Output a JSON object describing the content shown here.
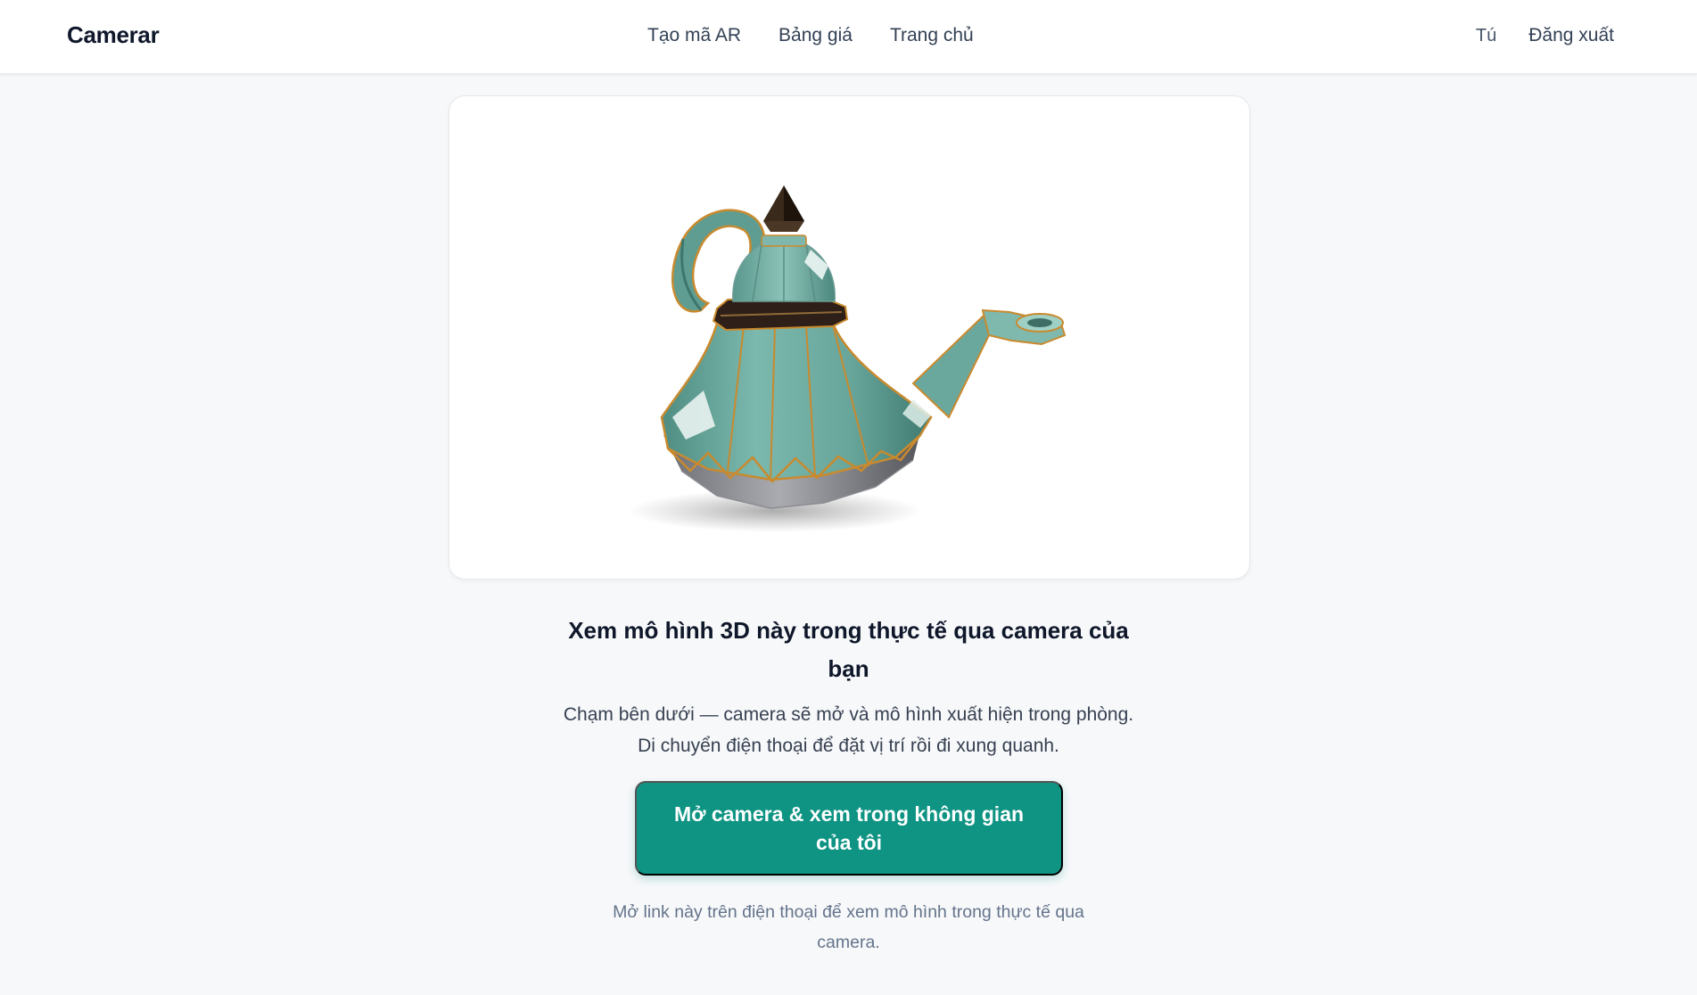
{
  "header": {
    "brand": "Camerar",
    "nav": [
      {
        "label": "Tạo mã AR"
      },
      {
        "label": "Bảng giá"
      },
      {
        "label": "Trang chủ"
      }
    ],
    "user_name": "Tú",
    "logout_label": "Đăng xuất"
  },
  "viewer": {
    "model_icon": "teapot-3d-model",
    "colors": {
      "body": "#6aa89e",
      "body_dark": "#4d8a80",
      "gold_trim": "#c98a2e",
      "finial": "#2b1d12"
    }
  },
  "main": {
    "headline": "Xem mô hình 3D này trong thực tế qua camera của bạn",
    "description": "Chạm bên dưới — camera sẽ mở và mô hình xuất hiện trong phòng. Di chuyển điện thoại để đặt vị trí rồi đi xung quanh.",
    "cta_label": "Mở camera & xem trong không gian của tôi",
    "footnote": "Mở link này trên điện thoại để xem mô hình trong thực tế qua camera."
  },
  "colors": {
    "accent": "#0f9484",
    "background": "#f7f8fa"
  }
}
